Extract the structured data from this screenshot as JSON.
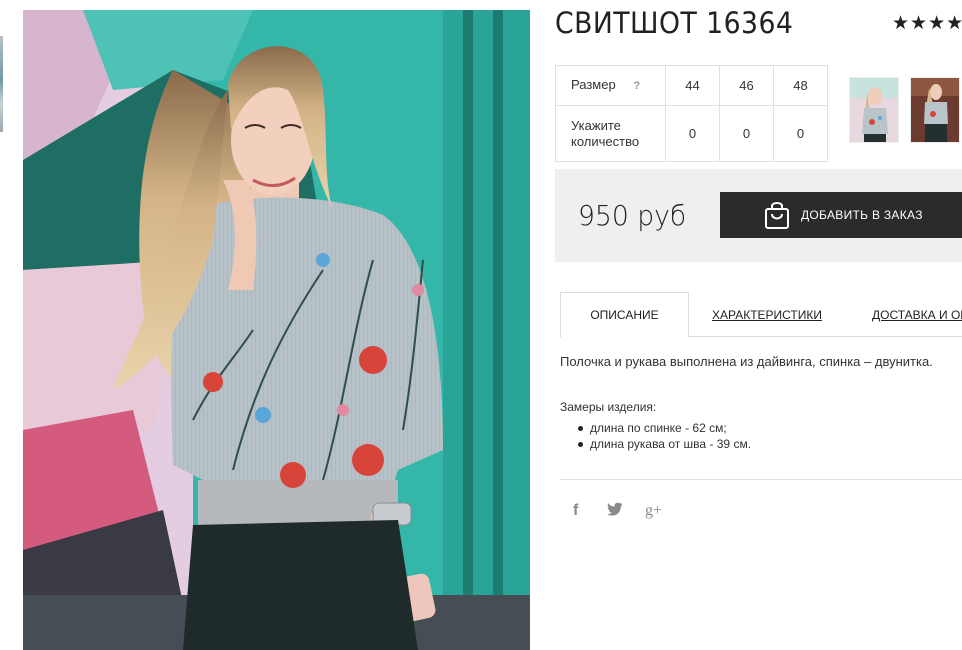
{
  "product": {
    "title": "СВИТШОТ 16364",
    "rating_stars": "★★★★",
    "rating": 4
  },
  "size_table": {
    "size_label": "Размер",
    "help_label": "?",
    "sizes": [
      "44",
      "46",
      "48"
    ],
    "quantity_label": "Укажите количество",
    "quantities": [
      "0",
      "0",
      "0"
    ]
  },
  "price": {
    "value": "950 руб"
  },
  "order_button": {
    "label": "ДОБАВИТЬ В ЗАКАЗ"
  },
  "tabs": [
    {
      "label": "ОПИСАНИЕ",
      "active": true
    },
    {
      "label": "ХАРАКТЕРИСТИКИ",
      "active": false
    },
    {
      "label": "ДОСТАВКА И ОПЛАТА",
      "active": false
    }
  ],
  "description": {
    "text": "Полочка и рукава выполнена из дайвинга, спинка – двунитка.",
    "measures_title": "Замеры изделия:",
    "measures": [
      "длина по спинке - 62 см;",
      "длина рукава от шва - 39 см."
    ]
  },
  "social": {
    "facebook": "f",
    "google_plus": "g+"
  },
  "colors": {
    "button_bg": "#2b2b2b",
    "price_box_bg": "#efefef",
    "photo_background": "#2fb3a6"
  }
}
